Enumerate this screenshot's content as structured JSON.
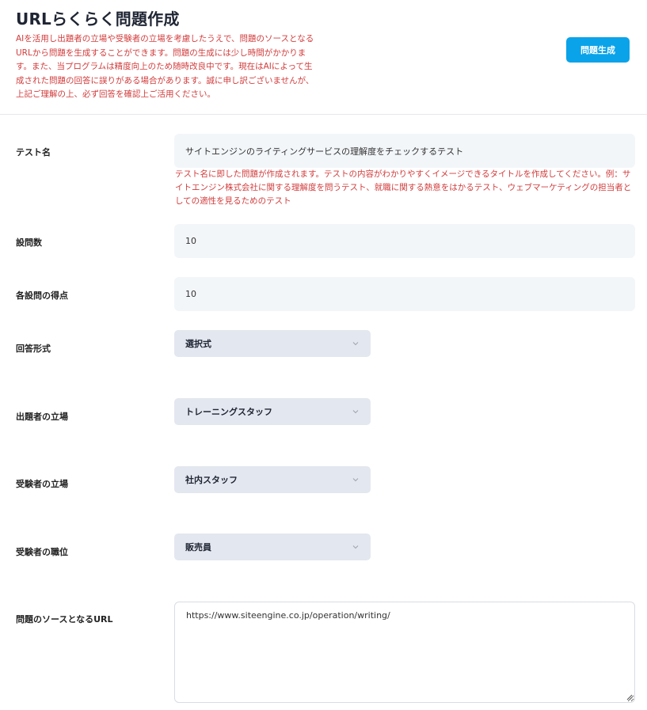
{
  "header": {
    "title": "URLらくらく問題作成",
    "description": "AIを活用し出題者の立場や受験者の立場を考慮したうえで、問題のソースとなるURLから問題を生成することができます。問題の生成には少し時間がかかります。また、当プログラムは精度向上のため随時改良中です。現在はAIによって生成された問題の回答に誤りがある場合があります。誠に申し訳ございませんが、上記ご理解の上、必ず回答を確認上ご活用ください。",
    "generate_button": "問題生成"
  },
  "form": {
    "test_name": {
      "label": "テスト名",
      "value": "サイトエンジンのライティングサービスの理解度をチェックするテスト",
      "hint": "テスト名に即した問題が作成されます。テストの内容がわかりやすくイメージできるタイトルを作成してください。例：サイトエンジン株式会社に関する理解度を問うテスト、就職に関する熱意をはかるテスト、ウェブマーケティングの担当者としての適性を見るためのテスト"
    },
    "question_count": {
      "label": "設問数",
      "value": "10"
    },
    "score_per_question": {
      "label": "各設問の得点",
      "value": "10"
    },
    "answer_format": {
      "label": "回答形式",
      "value": "選択式"
    },
    "examiner_role": {
      "label": "出題者の立場",
      "value": "トレーニングスタッフ"
    },
    "examinee_role": {
      "label": "受験者の立場",
      "value": "社内スタッフ"
    },
    "examinee_position": {
      "label": "受験者の職位",
      "value": "販売員"
    },
    "source_url": {
      "label": "問題のソースとなるURL",
      "value": "https://www.siteengine.co.jp/operation/writing/"
    }
  },
  "icons": {
    "select_chevron": "chevron-down-icon",
    "resize_grip": "resize-grip-icon"
  },
  "colors": {
    "accent": "#0aa3e9",
    "warning_text": "#d23c3c",
    "input_bg": "#f3f6f9",
    "select_bg": "#e3e7ef"
  }
}
